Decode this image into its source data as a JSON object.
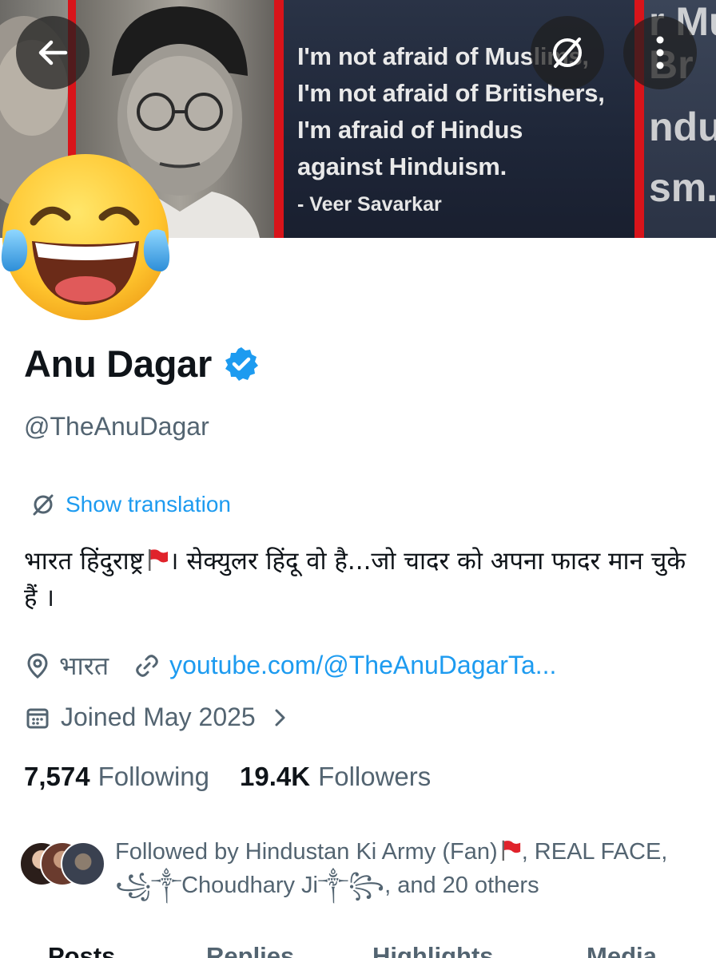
{
  "banner": {
    "quote_lines": [
      "I'm not afraid of Muslims,",
      "I'm not afraid of Britishers,",
      "I'm afraid of Hindus",
      "against Hinduism."
    ],
    "quote_author": "- Veer Savarkar",
    "edge_text": [
      "r Mu",
      "Br",
      "ndu",
      "sm."
    ]
  },
  "profile": {
    "name": "Anu Dagar",
    "handle": "@TheAnuDagar",
    "translate_label": "Show translation",
    "bio_part1": "भारत हिंदुराष्ट्र",
    "bio_part2": "। सेक्युलर हिंदू वो है...जो चादर को अपना फादर मान चुके हैं ।",
    "location": "भारत",
    "website": "youtube.com/@TheAnuDagarTa...",
    "joined": "Joined May 2025"
  },
  "stats": {
    "following_count": "7,574",
    "following_label": "Following",
    "followers_count": "19.4K",
    "followers_label": "Followers"
  },
  "followed_by": {
    "prefix": "Followed by Hindustan Ki Army (Fan)",
    "middle": ", REAL FACE, ꧁༒Choudhary Ji༒꧂",
    "suffix": ", and 20 others"
  },
  "tabs": [
    "Posts",
    "Replies",
    "Highlights",
    "Media"
  ],
  "colors": {
    "accent": "#1d9bf0",
    "secondary_text": "#536471",
    "primary_text": "#0f1419",
    "banner_red": "#d8141a"
  },
  "icons": {
    "back": "arrow-left-icon",
    "translate": "translate-icon",
    "more": "more-vertical-icon",
    "verified": "verified-badge-icon",
    "location": "location-pin-icon",
    "link": "link-icon",
    "calendar": "calendar-icon",
    "chevron": "chevron-right-icon"
  }
}
